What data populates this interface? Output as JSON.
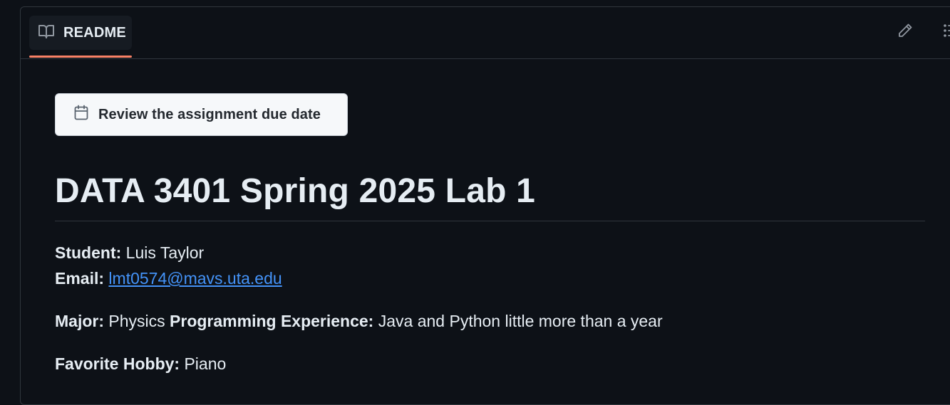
{
  "header": {
    "tab_label": "README",
    "icons": {
      "tab": "book-icon",
      "edit": "pencil-icon",
      "outline": "list-unordered-icon"
    },
    "accent_color": "#f78166"
  },
  "due_button": {
    "label": "Review the assignment due date",
    "icon": "calendar-icon"
  },
  "title": "DATA 3401 Spring 2025 Lab 1",
  "fields": {
    "student_label": "Student:",
    "student_value": "Luis Taylor",
    "email_label": "Email:",
    "email_value": "lmt0574@mavs.uta.edu",
    "major_label": "Major:",
    "major_value": "Physics",
    "experience_label": "Programming Experience:",
    "experience_value": "Java and Python little more than a year",
    "hobby_label": "Favorite Hobby:",
    "hobby_value": "Piano"
  },
  "colors": {
    "background": "#0d1117",
    "link": "#4493f8",
    "border": "#30363d"
  }
}
